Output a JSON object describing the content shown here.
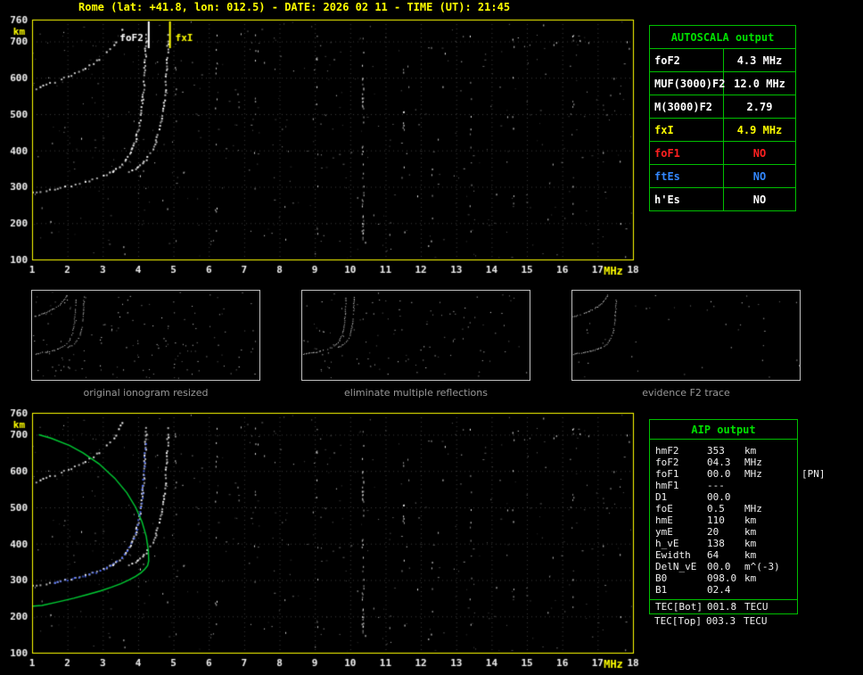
{
  "header": {
    "title": "Rome (lat: +41.8, lon: 012.5) - DATE: 2026 02 11 - TIME (UT): 21:45",
    "color": "#ffff00"
  },
  "autoscala": {
    "title": "AUTOSCALA output",
    "rows": [
      {
        "label": "foF2",
        "value": "4.3 MHz",
        "color": "#ffffff"
      },
      {
        "label": "MUF(3000)F2",
        "value": "12.0 MHz",
        "color": "#ffffff"
      },
      {
        "label": "M(3000)F2",
        "value": "2.79",
        "color": "#ffffff"
      },
      {
        "label": "fxI",
        "value": "4.9 MHz",
        "color": "#ffff00"
      },
      {
        "label": "foF1",
        "value": "NO",
        "color": "#ff2020"
      },
      {
        "label": "ftEs",
        "value": "NO",
        "color": "#3388ff"
      },
      {
        "label": "h'Es",
        "value": "NO",
        "color": "#ffffff"
      }
    ]
  },
  "thumbnails": [
    {
      "caption": "original ionogram resized",
      "shows": [
        "o",
        "x",
        "hop"
      ],
      "noise": 150
    },
    {
      "caption": "eliminate multiple reflections",
      "shows": [
        "o",
        "x"
      ],
      "noise": 115
    },
    {
      "caption": "evidence F2 trace",
      "shows": [
        "o",
        "hop"
      ],
      "noise": 40
    }
  ],
  "aip": {
    "title": "AIP output",
    "rows": [
      {
        "label": "hmF2",
        "value": "353",
        "unit": "km",
        "note": ""
      },
      {
        "label": "foF2",
        "value": "04.3",
        "unit": "MHz",
        "note": ""
      },
      {
        "label": "foF1",
        "value": "00.0",
        "unit": "MHz",
        "note": "[PN]"
      },
      {
        "label": "hmF1",
        "value": "---",
        "unit": "",
        "note": ""
      },
      {
        "label": "D1",
        "value": "00.0",
        "unit": "",
        "note": ""
      },
      {
        "label": "foE",
        "value": "0.5",
        "unit": "MHz",
        "note": ""
      },
      {
        "label": "hmE",
        "value": "110",
        "unit": "km",
        "note": ""
      },
      {
        "label": "ymE",
        "value": "20",
        "unit": "km",
        "note": ""
      },
      {
        "label": "h_vE",
        "value": "138",
        "unit": "km",
        "note": ""
      },
      {
        "label": "Ewidth",
        "value": "64",
        "unit": "km",
        "note": ""
      },
      {
        "label": "DelN_vE",
        "value": "00.0",
        "unit": "m^(-3)",
        "note": ""
      },
      {
        "label": "B0",
        "value": "098.0",
        "unit": "km",
        "note": ""
      },
      {
        "label": "B1",
        "value": "02.4",
        "unit": "",
        "note": ""
      }
    ],
    "tec_rows": [
      {
        "label": "TEC[Bot]",
        "value": "001.8",
        "unit": "TECU"
      },
      {
        "label": "TEC[Top]",
        "value": "003.3",
        "unit": "TECU"
      }
    ]
  },
  "chart_data": [
    {
      "id": "ionogram_main",
      "type": "scatter",
      "title": "",
      "xlabel": "MHz",
      "ylabel": "km",
      "xlim": [
        1,
        18
      ],
      "ylim": [
        100,
        760
      ],
      "x_ticks": [
        1,
        2,
        3,
        4,
        5,
        6,
        7,
        8,
        9,
        10,
        11,
        12,
        13,
        14,
        15,
        16,
        17,
        18
      ],
      "y_ticks": [
        100,
        200,
        300,
        400,
        500,
        600,
        700,
        760
      ],
      "colors": {
        "border": "#ffff00",
        "grid": "#3a3a3a",
        "ticks": "#f0f0f0",
        "units": "#ffff00",
        "trace": "#ffffff"
      },
      "markers": [
        {
          "label": "foF2",
          "f": 4.3,
          "color": "#ffffff",
          "side": "left"
        },
        {
          "label": "fxI",
          "f": 4.9,
          "color": "#ffff00",
          "side": "right"
        }
      ],
      "noise": {
        "uniform_dim": 300,
        "uniform_bright": 120
      },
      "rfi_columns": [
        [
          10.35,
          45
        ],
        [
          6.2,
          12
        ],
        [
          5.05,
          8
        ],
        [
          7.3,
          7
        ],
        [
          9.05,
          8
        ],
        [
          11.5,
          8
        ],
        [
          12.3,
          6
        ],
        [
          13.4,
          10
        ],
        [
          14.6,
          6
        ],
        [
          16.3,
          9
        ]
      ],
      "series": [
        {
          "name": "F2 ordinary trace (foF2 = 4.3 MHz)",
          "role": "o",
          "points": [
            [
              1,
              285
            ],
            [
              1.1,
              287
            ],
            [
              1.2,
              288
            ],
            [
              1.3,
              290
            ],
            [
              1.4,
              291
            ],
            [
              1.5,
              293
            ],
            [
              1.6,
              295
            ],
            [
              1.7,
              297
            ],
            [
              1.8,
              299
            ],
            [
              1.9,
              301
            ],
            [
              2,
              303
            ],
            [
              2.1,
              305
            ],
            [
              2.2,
              307
            ],
            [
              2.3,
              309
            ],
            [
              2.4,
              312
            ],
            [
              2.5,
              315
            ],
            [
              2.6,
              317
            ],
            [
              2.7,
              321
            ],
            [
              2.8,
              324
            ],
            [
              2.9,
              328
            ],
            [
              3,
              332
            ],
            [
              3.1,
              336
            ],
            [
              3.2,
              341
            ],
            [
              3.3,
              347
            ],
            [
              3.4,
              354
            ],
            [
              3.5,
              363
            ],
            [
              3.6,
              373
            ],
            [
              3.7,
              386
            ],
            [
              3.8,
              404
            ],
            [
              3.9,
              429
            ],
            [
              3.95,
              447
            ],
            [
              4,
              469
            ],
            [
              4.05,
              498
            ],
            [
              4.1,
              538
            ],
            [
              4.13,
              571
            ],
            [
              4.16,
              615
            ],
            [
              4.19,
              674
            ],
            [
              4.21,
              728
            ]
          ]
        },
        {
          "name": "F2 extraordinary trace (fxI = 4.9 MHz)",
          "role": "x",
          "points": [
            [
              3.6,
              337
            ],
            [
              3.7,
              341
            ],
            [
              3.8,
              346
            ],
            [
              3.9,
              352
            ],
            [
              4,
              359
            ],
            [
              4.1,
              367
            ],
            [
              4.2,
              377
            ],
            [
              4.3,
              390
            ],
            [
              4.4,
              406
            ],
            [
              4.5,
              430
            ],
            [
              4.6,
              465
            ],
            [
              4.65,
              491
            ],
            [
              4.7,
              526
            ],
            [
              4.75,
              577
            ],
            [
              4.8,
              658
            ],
            [
              4.83,
              734
            ]
          ]
        },
        {
          "name": "second hop (multiple reflection)",
          "role": "hop",
          "points": [
            [
              1,
              570
            ],
            [
              1.2,
              576
            ],
            [
              1.4,
              583
            ],
            [
              1.6,
              590
            ],
            [
              1.8,
              597
            ],
            [
              2,
              605
            ],
            [
              2.2,
              614
            ],
            [
              2.4,
              624
            ],
            [
              2.6,
              635
            ],
            [
              2.8,
              648
            ],
            [
              3,
              663
            ],
            [
              3.1,
              672
            ],
            [
              3.2,
              683
            ],
            [
              3.3,
              694
            ],
            [
              3.4,
              708
            ],
            [
              3.5,
              726
            ],
            [
              3.6,
              746
            ]
          ]
        }
      ]
    },
    {
      "id": "ionogram_profile",
      "type": "scatter",
      "title": "",
      "xlabel": "MHz",
      "ylabel": "km",
      "xlim": [
        1,
        18
      ],
      "ylim": [
        100,
        760
      ],
      "x_ticks": [
        1,
        2,
        3,
        4,
        5,
        6,
        7,
        8,
        9,
        10,
        11,
        12,
        13,
        14,
        15,
        16,
        17,
        18
      ],
      "y_ticks": [
        100,
        200,
        300,
        400,
        500,
        600,
        700,
        760
      ],
      "colors": {
        "border": "#ffff00",
        "grid": "#3a3a3a",
        "ticks": "#f0f0f0",
        "units": "#ffff00",
        "profile": "#00cc33",
        "restored": "#4f6fff"
      },
      "includes_series_from": "ionogram_main",
      "noise": {
        "uniform_dim": 300,
        "uniform_bright": 120
      },
      "rfi_columns": [
        [
          10.35,
          45
        ],
        [
          6.2,
          12
        ],
        [
          5.05,
          8
        ],
        [
          7.3,
          7
        ],
        [
          9.05,
          8
        ],
        [
          11.5,
          8
        ],
        [
          12.3,
          6
        ],
        [
          13.4,
          10
        ],
        [
          14.6,
          6
        ],
        [
          16.3,
          9
        ]
      ],
      "series": [
        {
          "name": "electron density profile (hmF2 = 353 km)",
          "role": "profile",
          "points": [
            [
              1,
              228
            ],
            [
              1.28,
              230
            ],
            [
              1.75,
              240
            ],
            [
              2.18,
              250
            ],
            [
              2.57,
              260
            ],
            [
              2.93,
              270
            ],
            [
              3.24,
              280
            ],
            [
              3.51,
              290
            ],
            [
              3.74,
              300
            ],
            [
              3.93,
              310
            ],
            [
              4.08,
              320
            ],
            [
              4.19,
              330
            ],
            [
              4.27,
              340
            ],
            [
              4.3,
              353
            ],
            [
              4.29,
              380
            ],
            [
              4.23,
              420
            ],
            [
              4.11,
              460
            ],
            [
              3.93,
              500
            ],
            [
              3.68,
              540
            ],
            [
              3.34,
              580
            ],
            [
              2.89,
              620
            ],
            [
              2.44,
              650
            ],
            [
              2.06,
              670
            ],
            [
              1.54,
              690
            ],
            [
              1.19,
              700
            ]
          ]
        },
        {
          "name": "restored F2 trace (autoscaled)",
          "role": "restored",
          "points": [
            [
              1.6,
              295
            ],
            [
              1.8,
              299
            ],
            [
              2,
              303
            ],
            [
              2.2,
              307
            ],
            [
              2.4,
              312
            ],
            [
              2.6,
              317
            ],
            [
              2.8,
              324
            ],
            [
              3,
              332
            ],
            [
              3.2,
              341
            ],
            [
              3.4,
              354
            ],
            [
              3.6,
              373
            ],
            [
              3.8,
              404
            ],
            [
              3.9,
              429
            ],
            [
              4,
              469
            ],
            [
              4.1,
              538
            ],
            [
              4.16,
              615
            ],
            [
              4.2,
              690
            ]
          ]
        }
      ]
    }
  ]
}
